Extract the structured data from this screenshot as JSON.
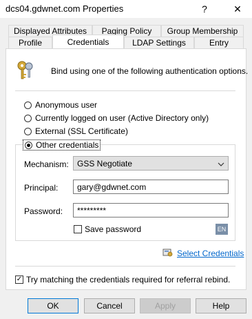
{
  "window": {
    "title": "dcs04.gdwnet.com Properties",
    "help_glyph": "?",
    "close_glyph": "✕"
  },
  "tabs": {
    "row1": [
      "Displayed Attributes",
      "Paging Policy",
      "Group Membership"
    ],
    "row2": [
      "Profile",
      "Credentials",
      "LDAP Settings",
      "Entry"
    ],
    "active": "Credentials"
  },
  "credentials": {
    "intro_text": "Bind using one of the following authentication options.",
    "options": [
      {
        "label": "Anonymous user",
        "checked": false
      },
      {
        "label": "Currently logged on user (Active Directory only)",
        "checked": false
      },
      {
        "label": "External (SSL Certificate)",
        "checked": false
      },
      {
        "label": "Other credentials",
        "checked": true
      }
    ],
    "mechanism_label": "Mechanism:",
    "mechanism_value": "GSS Negotiate",
    "principal_label": "Principal:",
    "principal_value": "gary@gdwnet.com",
    "password_label": "Password:",
    "password_value": "*********",
    "save_password_label": "Save password",
    "save_password_checked": false,
    "language_badge": "EN",
    "select_credentials_link": "Select Credentials",
    "referral_label": "Try matching the credentials required for referral rebind.",
    "referral_checked": true
  },
  "buttons": {
    "ok": "OK",
    "cancel": "Cancel",
    "apply": "Apply",
    "help": "Help"
  },
  "colors": {
    "accent": "#0078d7",
    "link": "#0066cc"
  }
}
